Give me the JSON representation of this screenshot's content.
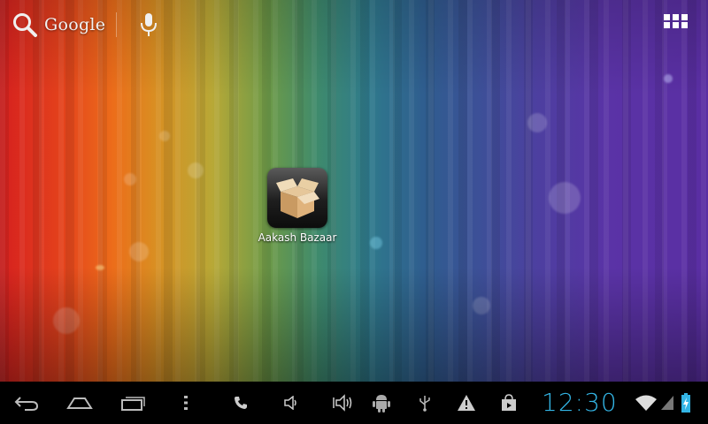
{
  "search_widget": {
    "brand_label": "Google",
    "search_icon": "search-icon",
    "voice_icon": "microphone-icon"
  },
  "apps_button": {
    "icon": "all-apps-grid-icon"
  },
  "home_shortcuts": [
    {
      "label": "Aakash Bazaar",
      "icon": "open-box-icon"
    }
  ],
  "navigation_bar": {
    "buttons": [
      {
        "name": "back",
        "icon": "back-arrow-icon"
      },
      {
        "name": "home",
        "icon": "home-icon"
      },
      {
        "name": "recent-apps",
        "icon": "recent-apps-icon"
      },
      {
        "name": "menu",
        "icon": "overflow-menu-icon"
      }
    ]
  },
  "status_area": {
    "notification_icons": [
      "phone-icon",
      "volume-icon",
      "vibrate-icon",
      "android-debug-icon",
      "usb-icon",
      "warning-icon",
      "store-bag-icon"
    ],
    "clock": "12:30",
    "wifi_icon": "wifi-icon",
    "signal_icon": "signal-icon",
    "battery_icon": "battery-charging-icon",
    "accent_color": "#33b5e5"
  }
}
